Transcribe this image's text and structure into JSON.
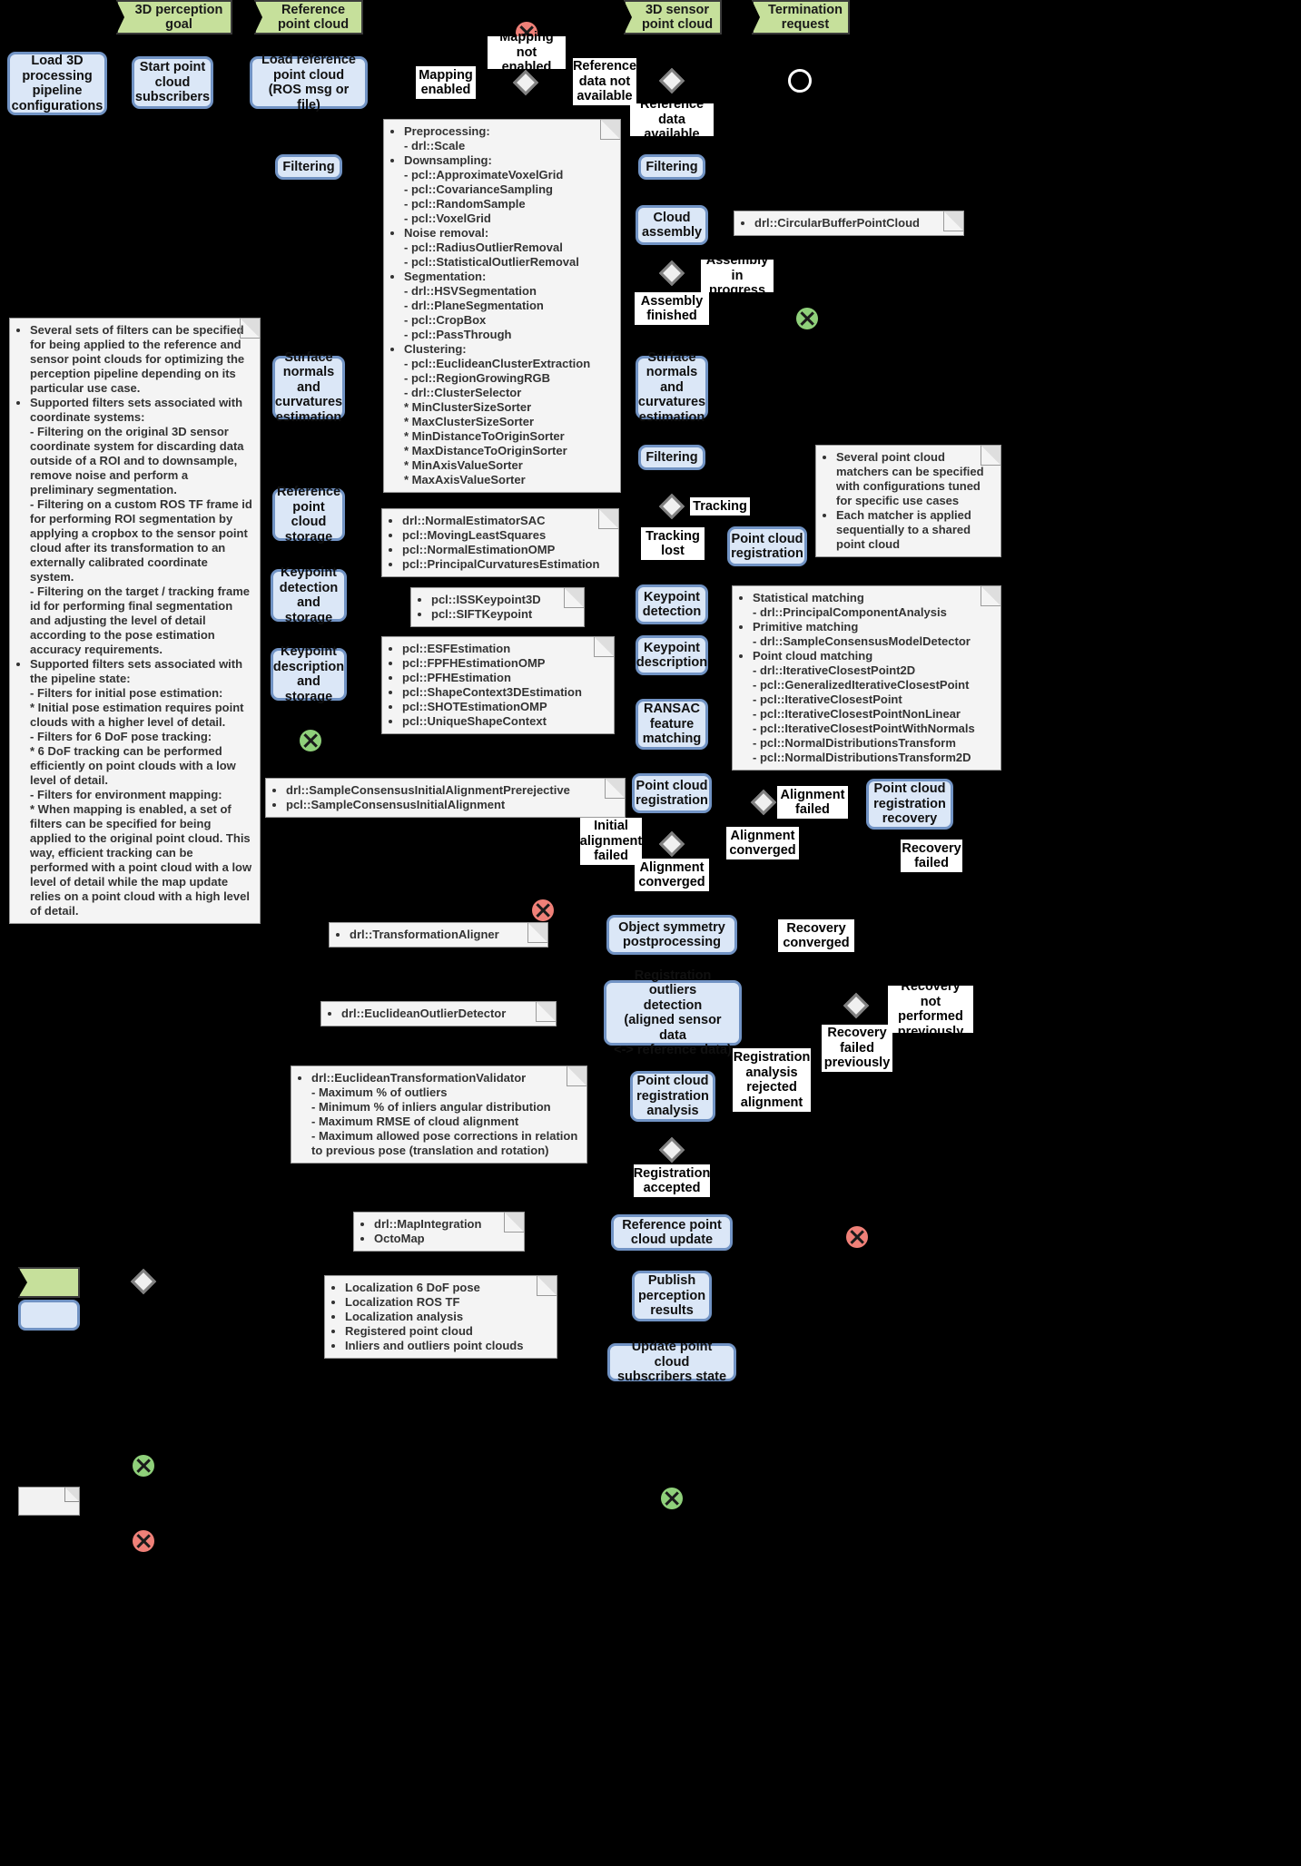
{
  "colors": {
    "background": "#000000",
    "signal_fill": "#c6e09b",
    "activity_fill": "#dbe7f7",
    "activity_border": "#7193c4",
    "note_fill": "#f4f4f4",
    "guard_fill": "#ffffff",
    "terminator_red": "#ef8078",
    "terminator_green": "#8fd07a",
    "decision_fill": "#f0f0f0"
  },
  "signals": [
    {
      "id": "sig-3d-perception-goal",
      "label": "3D perception\ngoal"
    },
    {
      "id": "sig-reference-point-cloud",
      "label": "Reference\npoint cloud"
    },
    {
      "id": "sig-3d-sensor-point-cloud",
      "label": "3D sensor\npoint cloud"
    },
    {
      "id": "sig-termination-request",
      "label": "Termination\nrequest"
    }
  ],
  "activities": {
    "load_pipeline_configurations": "Load 3D\nprocessing\npipeline\nconfigurations",
    "start_point_cloud_subscribers": "Start point\ncloud\nsubscribers",
    "load_reference_point_cloud": "Load reference\npoint cloud\n(ROS msg or file)",
    "filtering_reference": "Filtering",
    "surface_normals_reference": "Surface\nnormals and\ncurvatures\nestimation",
    "reference_point_cloud_storage": "Reference\npoint cloud\nstorage",
    "keypoint_detection_storage": "Keypoint\ndetection\nand storage",
    "keypoint_description_storage": "Keypoint\ndescription\nand storage",
    "filtering_sensor": "Filtering",
    "cloud_assembly": "Cloud\nassembly",
    "surface_normals_sensor": "Surface\nnormals and\ncurvatures\nestimation",
    "filtering_sensor_2": "Filtering",
    "keypoint_detection": "Keypoint\ndetection",
    "keypoint_description": "Keypoint\ndescription",
    "ransac_feature_matching": "RANSAC\nfeature\nmatching",
    "point_cloud_registration_initial": "Point cloud\nregistration",
    "point_cloud_registration_tracking": "Point cloud\nregistration",
    "point_cloud_registration_recovery": "Point cloud\nregistration\nrecovery",
    "object_symmetry_postprocessing": "Object symmetry\npostprocessing",
    "registration_outliers_detection": "Registration outliers\ndetection\n(aligned sensor data\n<-> reference data)",
    "point_cloud_registration_analysis": "Point cloud\nregistration\nanalysis",
    "reference_point_cloud_update": "Reference point\ncloud update",
    "publish_perception_results": "Publish\nperception\nresults",
    "update_point_cloud_subscribers_state": "Update point cloud\nsubscribers state"
  },
  "guards": {
    "mapping_enabled": "Mapping\nenabled",
    "mapping_not_enabled": "Mapping\nnot enabled",
    "reference_data_not_available": "Reference\ndata not\navailable",
    "reference_data_available": "Reference\ndata available",
    "assembly_in_progress": "Assembly\nin progress",
    "assembly_finished": "Assembly\nfinished",
    "tracking": "Tracking",
    "tracking_lost": "Tracking\nlost",
    "initial_alignment_failed": "Initial\nalignment\nfailed",
    "alignment_converged_initial": "Alignment\nconverged",
    "alignment_failed": "Alignment\nfailed",
    "alignment_converged_tracking": "Alignment\nconverged",
    "recovery_failed": "Recovery\nfailed",
    "recovery_converged": "Recovery\nconverged",
    "recovery_not_performed_previously": "Recovery\nnot performed\npreviously",
    "recovery_failed_previously": "Recovery\nfailed\npreviously",
    "registration_analysis_rejected_alignment": "Registration\nanalysis\nrejected\nalignment",
    "registration_accepted": "Registration\naccepted"
  },
  "notes": {
    "filters_note": {
      "items": [
        {
          "type": "bullet",
          "text": "Several sets of filters can be specified for being applied to the reference and sensor point clouds for optimizing the perception pipeline depending on its particular use case."
        },
        {
          "type": "bullet",
          "text": "Supported filters sets associated with coordinate systems:"
        },
        {
          "type": "plain",
          "text": "- Filtering on the original 3D sensor coordinate system for discarding data outside of a ROI and to downsample, remove noise and perform a preliminary segmentation."
        },
        {
          "type": "plain",
          "text": "- Filtering on a custom ROS TF frame id for performing ROI segmentation by applying a cropbox to the sensor point cloud after its transformation to an externally calibrated coordinate system."
        },
        {
          "type": "plain",
          "text": "- Filtering on the target / tracking frame id for performing final segmentation and adjusting the level of detail according to the pose estimation accuracy requirements."
        },
        {
          "type": "bullet",
          "text": "Supported filters sets associated with the pipeline state:"
        },
        {
          "type": "plain",
          "text": "- Filters for initial pose estimation:"
        },
        {
          "type": "plain",
          "text": "  * Initial pose estimation requires point clouds with a higher level of detail."
        },
        {
          "type": "plain",
          "text": "- Filters for 6 DoF pose tracking:"
        },
        {
          "type": "plain",
          "text": "  * 6 DoF tracking can be performed efficiently on point clouds with a low level of detail."
        },
        {
          "type": "plain",
          "text": "- Filters for environment mapping:"
        },
        {
          "type": "plain",
          "text": "  * When mapping is enabled, a set of filters can be specified for being applied to the original point cloud. This way, efficient tracking can be performed with a point cloud with a low level of detail while the map update relies on a point cloud with a high level of detail."
        }
      ]
    },
    "filtering_algorithms_note": {
      "items": [
        {
          "type": "bullet",
          "text": "Preprocessing:"
        },
        {
          "type": "sub",
          "text": "- drl::Scale"
        },
        {
          "type": "bullet",
          "text": "Downsampling:"
        },
        {
          "type": "sub",
          "text": "- pcl::ApproximateVoxelGrid"
        },
        {
          "type": "sub",
          "text": "- pcl::CovarianceSampling"
        },
        {
          "type": "sub",
          "text": "- pcl::RandomSample"
        },
        {
          "type": "sub",
          "text": "- pcl::VoxelGrid"
        },
        {
          "type": "bullet",
          "text": "Noise removal:"
        },
        {
          "type": "sub",
          "text": "- pcl::RadiusOutlierRemoval"
        },
        {
          "type": "sub",
          "text": "- pcl::StatisticalOutlierRemoval"
        },
        {
          "type": "bullet",
          "text": "Segmentation:"
        },
        {
          "type": "sub",
          "text": "- drl::HSVSegmentation"
        },
        {
          "type": "sub",
          "text": "- drl::PlaneSegmentation"
        },
        {
          "type": "sub",
          "text": "- pcl::CropBox"
        },
        {
          "type": "sub",
          "text": "- pcl::PassThrough"
        },
        {
          "type": "bullet",
          "text": "Clustering:"
        },
        {
          "type": "sub",
          "text": "- pcl::EuclideanClusterExtraction"
        },
        {
          "type": "sub",
          "text": "- pcl::RegionGrowingRGB"
        },
        {
          "type": "sub",
          "text": "- drl::ClusterSelector"
        },
        {
          "type": "sub",
          "text": "  * MinClusterSizeSorter"
        },
        {
          "type": "sub",
          "text": "  * MaxClusterSizeSorter"
        },
        {
          "type": "sub",
          "text": "  * MinDistanceToOriginSorter"
        },
        {
          "type": "sub",
          "text": "  * MaxDistanceToOriginSorter"
        },
        {
          "type": "sub",
          "text": "  * MinAxisValueSorter"
        },
        {
          "type": "sub",
          "text": "  * MaxAxisValueSorter"
        }
      ]
    },
    "circular_buffer_note": {
      "items": [
        {
          "type": "bullet",
          "text": "drl::CircularBufferPointCloud"
        }
      ]
    },
    "normals_note": {
      "items": [
        {
          "type": "bullet",
          "text": "drl::NormalEstimatorSAC"
        },
        {
          "type": "bullet",
          "text": "pcl::MovingLeastSquares"
        },
        {
          "type": "bullet",
          "text": "pcl::NormalEstimationOMP"
        },
        {
          "type": "bullet",
          "text": "pcl::PrincipalCurvaturesEstimation"
        }
      ]
    },
    "keypoint_detectors_note": {
      "items": [
        {
          "type": "bullet",
          "text": "pcl::ISSKeypoint3D"
        },
        {
          "type": "bullet",
          "text": "pcl::SIFTKeypoint"
        }
      ]
    },
    "keypoint_descriptors_note": {
      "items": [
        {
          "type": "bullet",
          "text": "pcl::ESFEstimation"
        },
        {
          "type": "bullet",
          "text": "pcl::FPFHEstimationOMP"
        },
        {
          "type": "bullet",
          "text": "pcl::PFHEstimation"
        },
        {
          "type": "bullet",
          "text": "pcl::ShapeContext3DEstimation"
        },
        {
          "type": "bullet",
          "text": "pcl::SHOTEstimationOMP"
        },
        {
          "type": "bullet",
          "text": "pcl::UniqueShapeContext"
        }
      ]
    },
    "matchers_note": {
      "items": [
        {
          "type": "bullet",
          "text": "Several point cloud matchers can be specified with configurations tuned for specific use cases"
        },
        {
          "type": "bullet",
          "text": "Each matcher is applied sequentially to a shared point cloud"
        }
      ]
    },
    "matching_algorithms_note": {
      "items": [
        {
          "type": "bullet",
          "text": "Statistical matching"
        },
        {
          "type": "sub",
          "text": "- drl::PrincipalComponentAnalysis"
        },
        {
          "type": "bullet",
          "text": "Primitive matching"
        },
        {
          "type": "sub",
          "text": "- drl::SampleConsensusModelDetector"
        },
        {
          "type": "bullet",
          "text": "Point cloud matching"
        },
        {
          "type": "sub",
          "text": "- drl::IterativeClosestPoint2D"
        },
        {
          "type": "sub",
          "text": "- pcl::GeneralizedIterativeClosestPoint"
        },
        {
          "type": "sub",
          "text": "- pcl::IterativeClosestPoint"
        },
        {
          "type": "sub",
          "text": "- pcl::IterativeClosestPointNonLinear"
        },
        {
          "type": "sub",
          "text": "- pcl::IterativeClosestPointWithNormals"
        },
        {
          "type": "sub",
          "text": "- pcl::NormalDistributionsTransform"
        },
        {
          "type": "sub",
          "text": "- pcl::NormalDistributionsTransform2D"
        }
      ]
    },
    "initial_alignment_note": {
      "items": [
        {
          "type": "bullet",
          "text": "drl::SampleConsensusInitialAlignmentPrerejective"
        },
        {
          "type": "bullet",
          "text": "pcl::SampleConsensusInitialAlignment"
        }
      ]
    },
    "transformation_aligner_note": {
      "items": [
        {
          "type": "bullet",
          "text": "drl::TransformationAligner"
        }
      ]
    },
    "euclidean_outlier_note": {
      "items": [
        {
          "type": "bullet",
          "text": "drl::EuclideanOutlierDetector"
        }
      ]
    },
    "transformation_validator_note": {
      "items": [
        {
          "type": "bullet",
          "text": "drl::EuclideanTransformationValidator"
        },
        {
          "type": "sub",
          "text": "- Maximum % of outliers"
        },
        {
          "type": "sub",
          "text": "- Minimum % of inliers angular distribution"
        },
        {
          "type": "sub",
          "text": "- Maximum RMSE of cloud alignment"
        },
        {
          "type": "sub",
          "text": "- Maximum allowed pose corrections in relation to previous pose (translation and rotation)"
        }
      ]
    },
    "map_integration_note": {
      "items": [
        {
          "type": "bullet",
          "text": "drl::MapIntegration"
        },
        {
          "type": "bullet",
          "text": "OctoMap"
        }
      ]
    },
    "results_note": {
      "items": [
        {
          "type": "bullet",
          "text": "Localization 6 DoF pose"
        },
        {
          "type": "bullet",
          "text": "Localization ROS TF"
        },
        {
          "type": "bullet",
          "text": "Localization analysis"
        },
        {
          "type": "bullet",
          "text": "Registered point cloud"
        },
        {
          "type": "bullet",
          "text": "Inliers and outliers point clouds"
        }
      ]
    }
  },
  "legend": {
    "shapes": [
      {
        "name": "signal-swatch"
      },
      {
        "name": "activity-swatch"
      },
      {
        "name": "note-swatch"
      },
      {
        "name": "decision-swatch"
      },
      {
        "name": "green-terminator-swatch"
      },
      {
        "name": "red-terminator-swatch"
      }
    ]
  }
}
